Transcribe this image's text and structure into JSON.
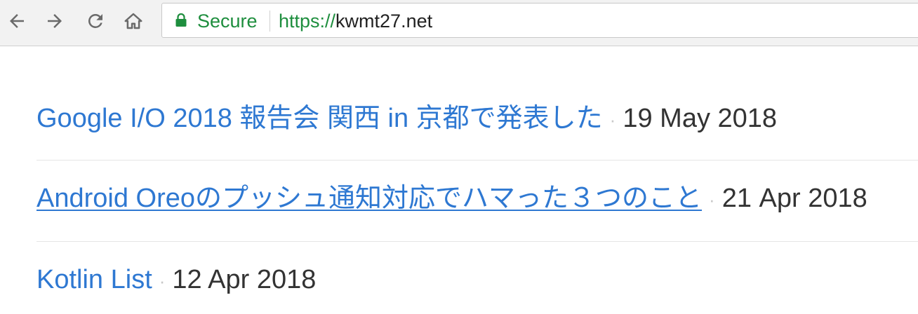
{
  "browser": {
    "secure_label": "Secure",
    "url_scheme": "https://",
    "url_host": "kwmt27.net",
    "icons": [
      "back-arrow-icon",
      "forward-arrow-icon",
      "reload-icon",
      "home-icon",
      "lock-icon"
    ],
    "secure_color": "#1e8e3e"
  },
  "posts": [
    {
      "title": "Google I/O 2018 報告会 関西 in 京都で発表した",
      "separator": "·",
      "date": "19 May 2018"
    },
    {
      "title": "Android Oreoのプッシュ通知対応でハマった３つのこと",
      "separator": "·",
      "date": "21 Apr 2018"
    },
    {
      "title": "Kotlin List",
      "separator": "·",
      "date": "12 Apr 2018"
    }
  ],
  "colors": {
    "link": "#2e78d2",
    "date": "#333333"
  }
}
